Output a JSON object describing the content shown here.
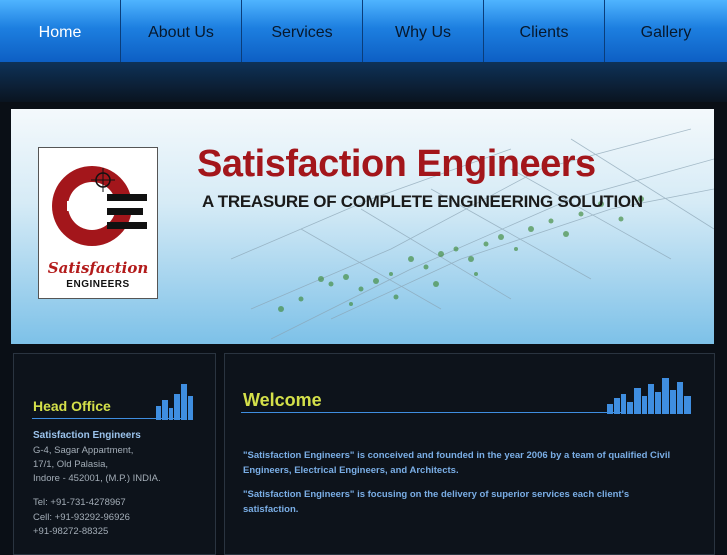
{
  "nav": {
    "items": [
      "Home",
      "About Us",
      "Services",
      "Why Us",
      "Clients",
      "Gallery"
    ]
  },
  "banner": {
    "title": "Satisfaction Engineers",
    "tagline": "A TREASURE OF COMPLETE ENGINEERING SOLUTION",
    "logo_name": "Satisfaction",
    "logo_sub": "ENGINEERS"
  },
  "head_office": {
    "heading": "Head Office",
    "company": "Satisfaction Engineers",
    "address": [
      "G-4, Sagar Appartment,",
      "17/1, Old Palasia,",
      "Indore - 452001, (M.P.) INDIA."
    ],
    "phones": [
      "Tel: +91-731-4278967",
      "Cell: +91-93292-96926",
      "+91-98272-88325"
    ]
  },
  "welcome": {
    "heading": "Welcome",
    "paragraphs": [
      "\"Satisfaction Engineers\" is conceived and founded in the year 2006 by a team of qualified Civil Engineers, Electrical Engineers, and Architects.",
      "\"Satisfaction Engineers\" is focusing on the delivery of superior services each client's satisfaction."
    ]
  }
}
